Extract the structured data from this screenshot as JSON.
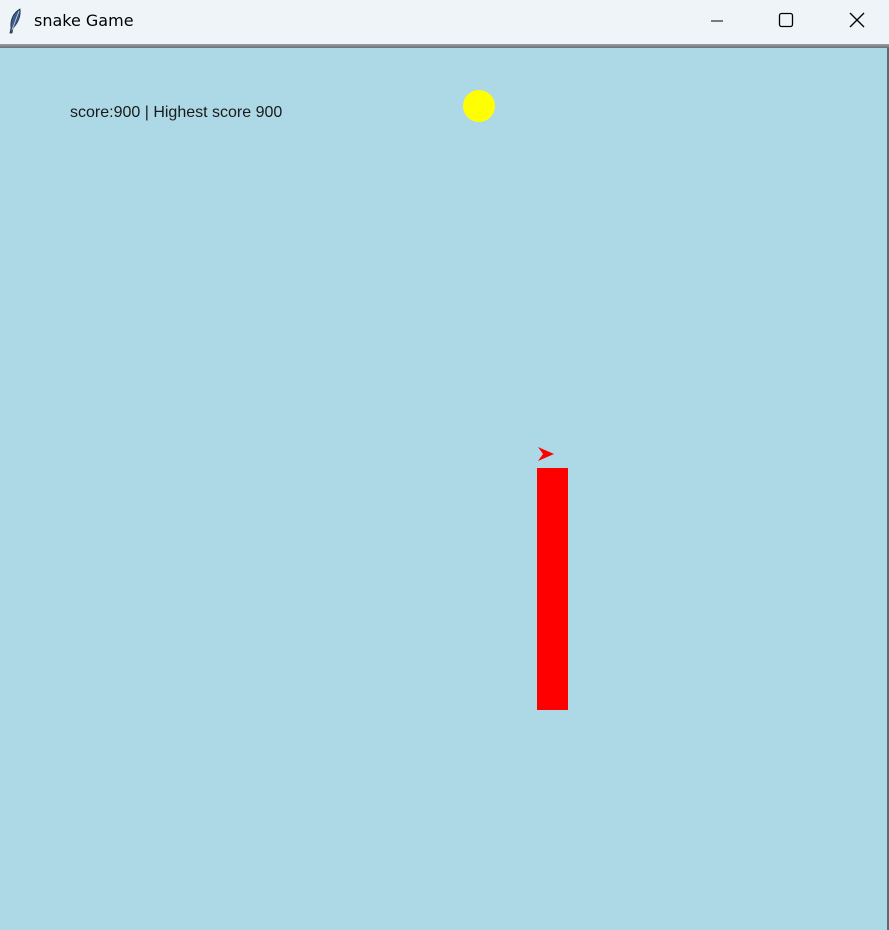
{
  "window": {
    "title": "snake Game",
    "app_icon": "feather-icon",
    "controls": {
      "minimize": "minimize-icon",
      "maximize": "maximize-icon",
      "close": "close-icon"
    }
  },
  "game": {
    "score_text": "score:900 | Highest score 900",
    "score": 900,
    "highest_score": 900,
    "colors": {
      "background": "#add8e6",
      "snake": "#ff0000",
      "food": "#ffff00",
      "text": "#1a1a1a"
    },
    "snake": {
      "direction": "right",
      "head_icon": "arrow-right-icon"
    }
  }
}
